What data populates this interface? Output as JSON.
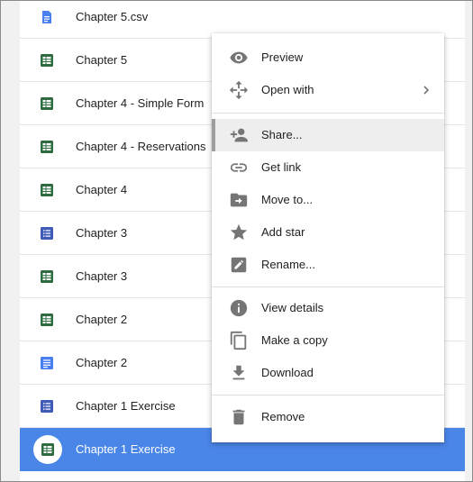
{
  "files": [
    {
      "name": "Chapter 5.csv",
      "type": "doc"
    },
    {
      "name": "Chapter 5",
      "type": "sheet"
    },
    {
      "name": "Chapter 4 - Simple Form",
      "type": "sheet"
    },
    {
      "name": "Chapter 4 - Reservations",
      "type": "sheet"
    },
    {
      "name": "Chapter 4",
      "type": "sheet"
    },
    {
      "name": "Chapter 3",
      "type": "form"
    },
    {
      "name": "Chapter 3",
      "type": "sheet"
    },
    {
      "name": "Chapter 2",
      "type": "sheet"
    },
    {
      "name": "Chapter 2",
      "type": "doc"
    },
    {
      "name": "Chapter 1 Exercise",
      "type": "form"
    },
    {
      "name": "Chapter 1 Exercise",
      "type": "sheet",
      "selected": true
    }
  ],
  "menu": {
    "items": [
      {
        "label": "Preview",
        "icon": "eye-icon"
      },
      {
        "label": "Open with",
        "icon": "move-arrows-icon",
        "submenu": true
      },
      {
        "label": "Share...",
        "icon": "person-add-icon",
        "highlighted": true
      },
      {
        "label": "Get link",
        "icon": "link-icon"
      },
      {
        "label": "Move to...",
        "icon": "folder-move-icon"
      },
      {
        "label": "Add star",
        "icon": "star-icon"
      },
      {
        "label": "Rename...",
        "icon": "pencil-icon"
      },
      {
        "label": "View details",
        "icon": "info-icon"
      },
      {
        "label": "Make a copy",
        "icon": "copy-icon"
      },
      {
        "label": "Download",
        "icon": "download-icon"
      },
      {
        "label": "Remove",
        "icon": "trash-icon"
      }
    ]
  },
  "colors": {
    "sheet_icon": "#2e6b3f",
    "form_icon": "#3f5bb5",
    "doc_icon": "#4a7ff0",
    "selection": "#4a86e8",
    "menu_icon": "#757575"
  }
}
